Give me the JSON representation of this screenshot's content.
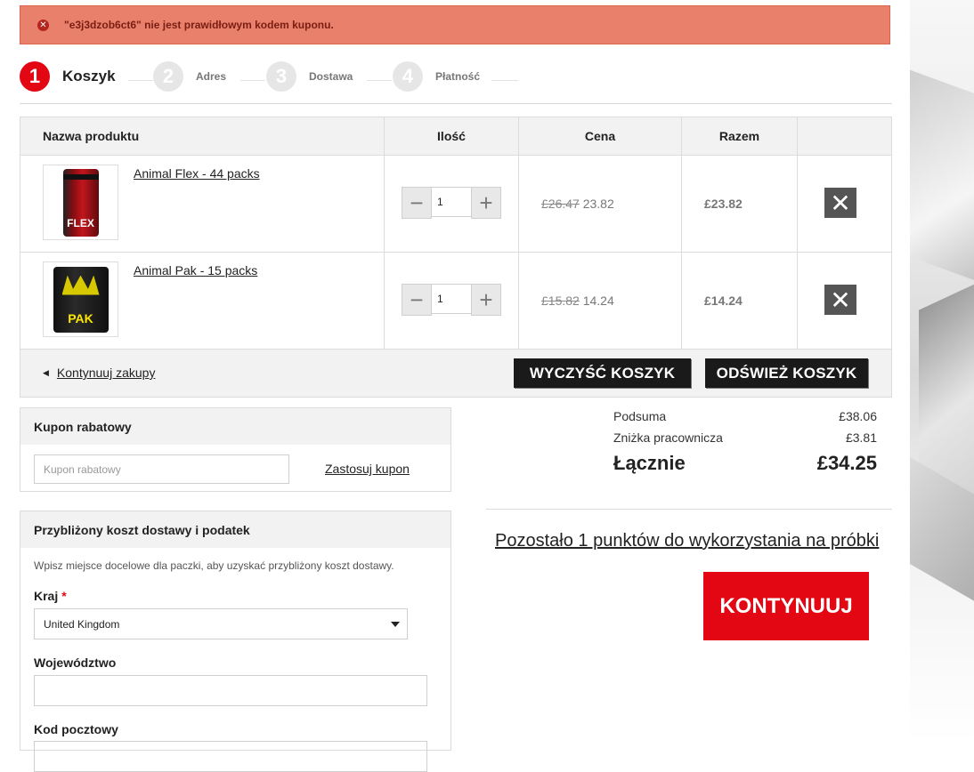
{
  "error": {
    "message": "\"e3j3dzob6ct6\" nie jest prawidłowym kodem kuponu."
  },
  "steps": [
    {
      "num": "1",
      "label": "Koszyk"
    },
    {
      "num": "2",
      "label": "Adres"
    },
    {
      "num": "3",
      "label": "Dostawa"
    },
    {
      "num": "4",
      "label": "Płatność"
    }
  ],
  "cart": {
    "headers": {
      "product": "Nazwa produktu",
      "qty": "Ilość",
      "price": "Cena",
      "total": "Razem"
    },
    "items": [
      {
        "name": "Animal Flex - 44 packs",
        "can_text": "FLEX",
        "qty": "1",
        "old_price": "£26.47",
        "price": "23.82",
        "total": "£23.82"
      },
      {
        "name": "Animal Pak - 15 packs",
        "can_text": "PAK",
        "qty": "1",
        "old_price": "£15.82",
        "price": "14.24",
        "total": "£14.24"
      }
    ],
    "continue_label": "Kontynuuj zakupy",
    "clear_label": "WYCZYŚĆ KOSZYK",
    "refresh_label": "ODŚWIEŻ KOSZYK"
  },
  "coupon": {
    "title": "Kupon rabatowy",
    "placeholder": "Kupon rabatowy",
    "apply_label": "Zastosuj kupon"
  },
  "shipping": {
    "title": "Przybliżony koszt dostawy i podatek",
    "description": "Wpisz miejsce docelowe dla paczki, aby uzyskać przybliżony koszt dostawy.",
    "country_label": "Kraj",
    "required_mark": "*",
    "country_value": "United Kingdom",
    "region_label": "Województwo",
    "postcode_label": "Kod pocztowy"
  },
  "summary": {
    "subtotal_label": "Podsuma",
    "subtotal": "£38.06",
    "discount_label": "Zniżka pracownicza",
    "discount": "£3.81",
    "total_label": "Łącznie",
    "total": "£34.25"
  },
  "points_text": "Pozostało 1 punktów do wykorzystania na próbki",
  "continue_button": "KONTYNUUJ",
  "colors": {
    "accent": "#e30613",
    "error_bg": "#e8806b",
    "dark_button": "#1a1a1a"
  }
}
